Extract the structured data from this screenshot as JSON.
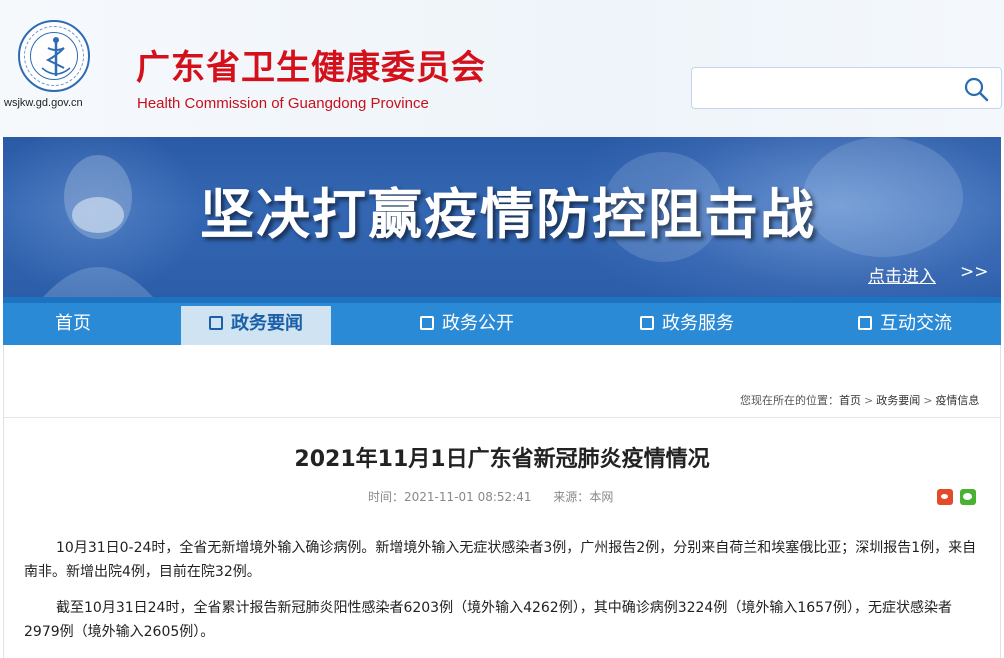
{
  "header": {
    "site_url": "wsjkw.gd.gov.cn",
    "org_name": "广东省卫生健康委员会",
    "org_name_en": "Health Commission of Guangdong Province",
    "emblem_text": "广东省卫生健康委员会",
    "search": {
      "value": "",
      "placeholder": ""
    }
  },
  "banner": {
    "title": "坚决打赢疫情防控阻击战",
    "cta": "点击进入",
    "cta_arrows": ">>"
  },
  "nav": {
    "items": [
      {
        "label": "首页",
        "active": false
      },
      {
        "label": "政务要闻",
        "active": true
      },
      {
        "label": "政务公开",
        "active": false
      },
      {
        "label": "政务服务",
        "active": false
      },
      {
        "label": "互动交流",
        "active": false
      }
    ]
  },
  "breadcrumb": {
    "prefix": "您现在所在的位置：",
    "items": [
      "首页",
      "政务要闻",
      "疫情信息"
    ],
    "separator": ">"
  },
  "article": {
    "title": "2021年11月1日广东省新冠肺炎疫情情况",
    "time_label": "时间：",
    "time": "2021-11-01 08:52:41",
    "source_label": "来源：",
    "source": "本网",
    "paragraphs": [
      "10月31日0-24时，全省无新增境外输入确诊病例。新增境外输入无症状感染者3例，广州报告2例，分别来自荷兰和埃塞俄比亚；深圳报告1例，来自南非。新增出院4例，目前在院32例。",
      "截至10月31日24时，全省累计报告新冠肺炎阳性感染者6203例（境外输入4262例），其中确诊病例3224例（境外输入1657例），无症状感染者2979例（境外输入2605例）。"
    ]
  },
  "colors": {
    "brand_red": "#d4111b",
    "nav_blue": "#2b8ad6",
    "nav_active_bg": "#cfe3f3",
    "banner_blue": "#3467b3"
  }
}
